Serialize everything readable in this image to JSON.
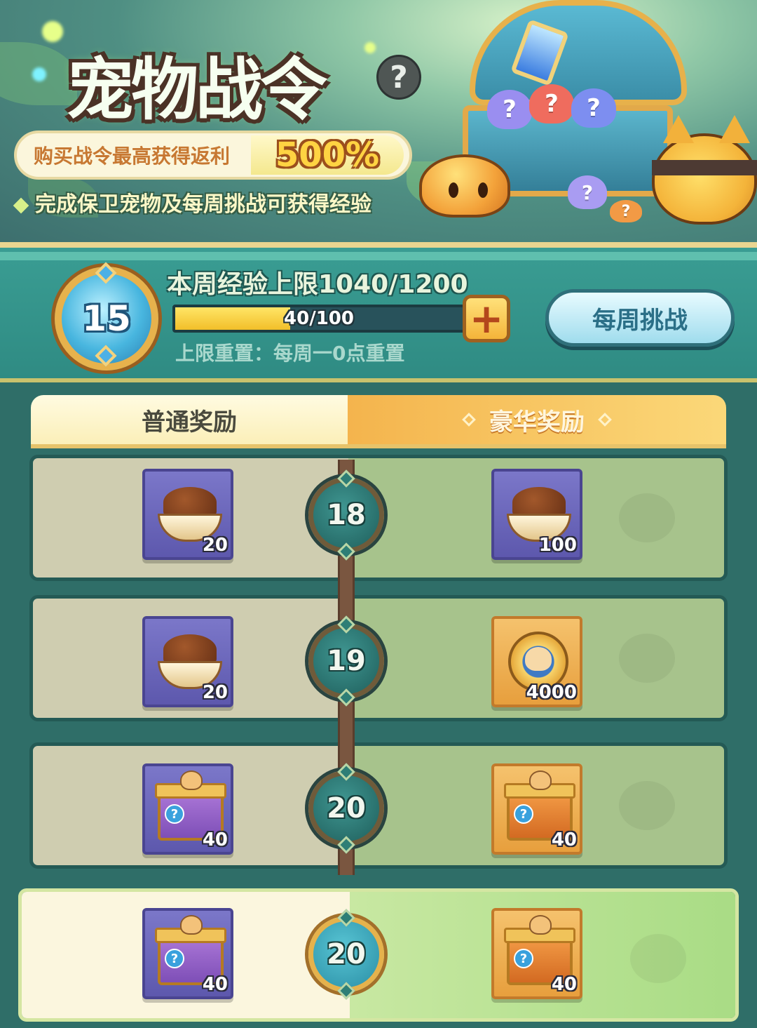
{
  "banner": {
    "title": "宠物战令",
    "help_icon": "question-icon",
    "promo_text": "购买战令最高获得返利",
    "promo_value": "500%",
    "hint": "完成保卫宠物及每周挑战可获得经验"
  },
  "header": {
    "level": "15",
    "weekly_exp_cap": "本周经验上限1040/1200",
    "progress_text": "40/100",
    "progress_fraction": 0.4,
    "plus_icon": "plus-icon",
    "reset_text": "上限重置：每周一0点重置",
    "weekly_button": "每周挑战"
  },
  "tabs": {
    "normal": "普通奖励",
    "luxury": "豪华奖励"
  },
  "rows": [
    {
      "level": "18",
      "normal": {
        "icon": "pet-food-icon",
        "qty": "20"
      },
      "luxury": {
        "icon": "pet-food-icon",
        "qty": "100"
      }
    },
    {
      "level": "19",
      "normal": {
        "icon": "pet-food-icon",
        "qty": "20"
      },
      "luxury": {
        "icon": "gold-coin-icon",
        "qty": "4000"
      }
    },
    {
      "level": "20",
      "normal": {
        "icon": "mystery-box-icon",
        "qty": "40"
      },
      "luxury": {
        "icon": "mystery-box-icon",
        "qty": "40"
      }
    },
    {
      "level": "20",
      "normal": {
        "icon": "mystery-box-icon",
        "qty": "40"
      },
      "luxury": {
        "icon": "mystery-box-icon",
        "qty": "40"
      }
    }
  ],
  "colors": {
    "accent_gold": "#f4b43a",
    "panel_teal": "#3a9d93",
    "normal_tab": "#fbefb8",
    "luxury_tab": "#f4b44d"
  }
}
